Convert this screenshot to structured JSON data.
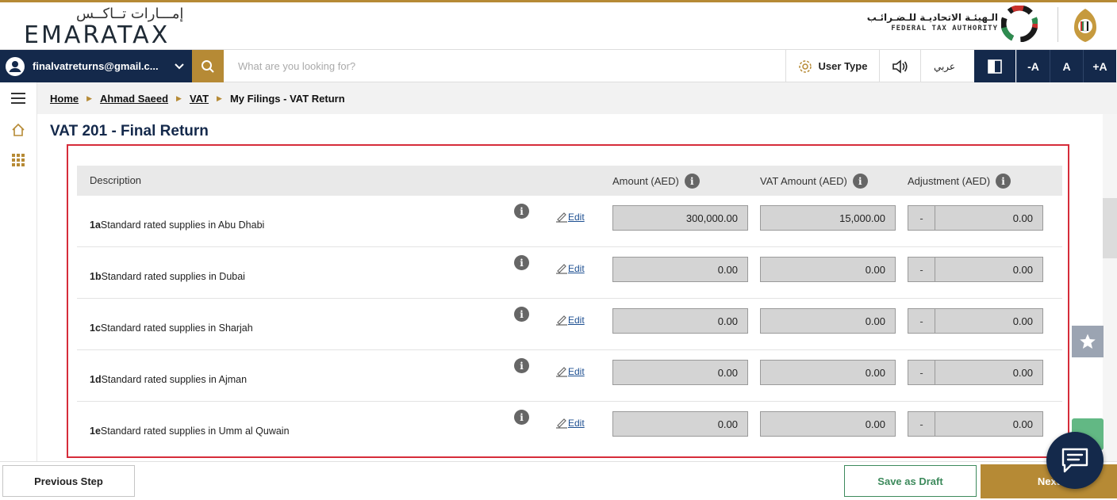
{
  "header": {
    "logo_arabic": "إمـــارات تــاكــس",
    "logo_english": "EMARATAX",
    "authority_arabic": "الـهيئـة الاتحاديـة للـضـرائـب",
    "authority_english": "FEDERAL TAX AUTHORITY"
  },
  "toolbar": {
    "user_email": "finalvatreturns@gmail.c...",
    "search_placeholder": "What are you looking for?",
    "user_type_label": "User Type",
    "language_label": "عربي",
    "font_decrease": "-A",
    "font_normal": "A",
    "font_increase": "+A"
  },
  "breadcrumb": {
    "items": [
      "Home",
      "Ahmad Saeed",
      "VAT",
      "My Filings - VAT Return"
    ]
  },
  "page": {
    "title": "VAT 201 - Final Return"
  },
  "table": {
    "headers": {
      "description": "Description",
      "amount": "Amount (AED)",
      "vat_amount": "VAT Amount (AED)",
      "adjustment": "Adjustment (AED)"
    },
    "info_symbol": "i",
    "edit_label": "Edit",
    "rows": [
      {
        "code": "1a",
        "description": "Standard rated supplies in Abu Dhabi",
        "amount": "300,000.00",
        "vat_amount": "15,000.00",
        "adj_sign": "-",
        "adjustment": "0.00"
      },
      {
        "code": "1b",
        "description": "Standard rated supplies in Dubai",
        "amount": "0.00",
        "vat_amount": "0.00",
        "adj_sign": "-",
        "adjustment": "0.00"
      },
      {
        "code": "1c",
        "description": "Standard rated supplies in Sharjah",
        "amount": "0.00",
        "vat_amount": "0.00",
        "adj_sign": "-",
        "adjustment": "0.00"
      },
      {
        "code": "1d",
        "description": "Standard rated supplies in Ajman",
        "amount": "0.00",
        "vat_amount": "0.00",
        "adj_sign": "-",
        "adjustment": "0.00"
      },
      {
        "code": "1e",
        "description": "Standard rated supplies in Umm al Quwain",
        "amount": "0.00",
        "vat_amount": "0.00",
        "adj_sign": "-",
        "adjustment": "0.00"
      }
    ]
  },
  "footer": {
    "previous_label": "Previous Step",
    "draft_label": "Save as Draft",
    "next_label": "Next"
  },
  "colors": {
    "navy": "#14294b",
    "gold": "#b68a35",
    "highlight_frame": "#d62c3a",
    "draft_green": "#3d8a5c"
  }
}
